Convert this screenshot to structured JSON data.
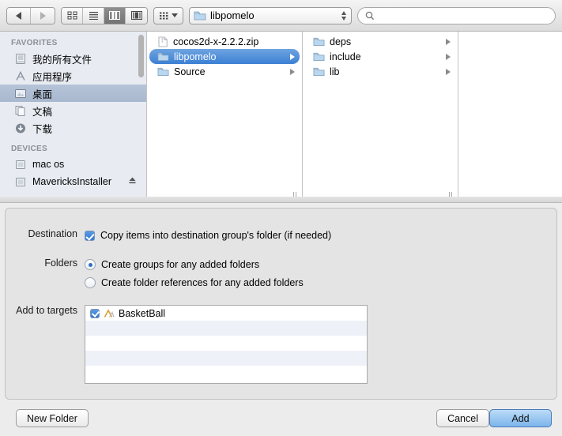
{
  "toolbar": {
    "back_icon": "back-arrow-icon",
    "forward_icon": "forward-arrow-icon",
    "view_modes": [
      {
        "name": "icon-view",
        "selected": false
      },
      {
        "name": "list-view",
        "selected": false
      },
      {
        "name": "column-view",
        "selected": true
      },
      {
        "name": "coverflow-view",
        "selected": false
      }
    ],
    "arrange_icon": "arrange-grid-icon",
    "path_popup": {
      "value": "libpomelo",
      "icon": "folder-icon"
    },
    "search": {
      "value": "",
      "placeholder": "",
      "icon": "search-icon"
    }
  },
  "sidebar": {
    "sections": [
      {
        "title": "FAVORITES",
        "items": [
          {
            "label": "我的所有文件",
            "icon": "all-my-files-icon",
            "selected": false,
            "eject": false
          },
          {
            "label": "应用程序",
            "icon": "applications-icon",
            "selected": false,
            "eject": false
          },
          {
            "label": "桌面",
            "icon": "desktop-icon",
            "selected": true,
            "eject": false
          },
          {
            "label": "文稿",
            "icon": "documents-icon",
            "selected": false,
            "eject": false
          },
          {
            "label": "下载",
            "icon": "downloads-icon",
            "selected": false,
            "eject": false
          }
        ]
      },
      {
        "title": "DEVICES",
        "items": [
          {
            "label": "mac os",
            "icon": "disk-icon",
            "selected": false,
            "eject": false
          },
          {
            "label": "MavericksInstaller",
            "icon": "disk-icon",
            "selected": false,
            "eject": true
          }
        ]
      }
    ]
  },
  "browser": {
    "columns": [
      {
        "rows": [
          {
            "label": "cocos2d-x-2.2.2.zip",
            "icon": "zip-file-icon",
            "selected": false,
            "has_children": false
          },
          {
            "label": "libpomelo",
            "icon": "folder-icon",
            "selected": true,
            "has_children": true
          },
          {
            "label": "Source",
            "icon": "folder-icon",
            "selected": false,
            "has_children": true
          }
        ]
      },
      {
        "rows": [
          {
            "label": "deps",
            "icon": "folder-icon",
            "selected": false,
            "has_children": true
          },
          {
            "label": "include",
            "icon": "folder-icon",
            "selected": false,
            "has_children": true
          },
          {
            "label": "lib",
            "icon": "folder-icon",
            "selected": false,
            "has_children": true
          }
        ]
      }
    ]
  },
  "options": {
    "destination_label": "Destination",
    "copy_items_label": "Copy items into destination group's folder (if needed)",
    "copy_items_checked": true,
    "folders_label": "Folders",
    "create_groups_label": "Create groups for any added folders",
    "create_groups_selected": true,
    "create_references_label": "Create folder references for any added folders",
    "create_references_selected": false,
    "targets_label": "Add to targets",
    "targets": [
      {
        "label": "BasketBall",
        "checked": true,
        "icon": "xcode-target-icon"
      }
    ]
  },
  "buttons": {
    "new_folder": "New Folder",
    "cancel": "Cancel",
    "add": "Add"
  },
  "colors": {
    "selection_blue": "#3b7fd4",
    "sidebar_bg": "#e8ecf2",
    "default_button": "#7bb4ea"
  }
}
